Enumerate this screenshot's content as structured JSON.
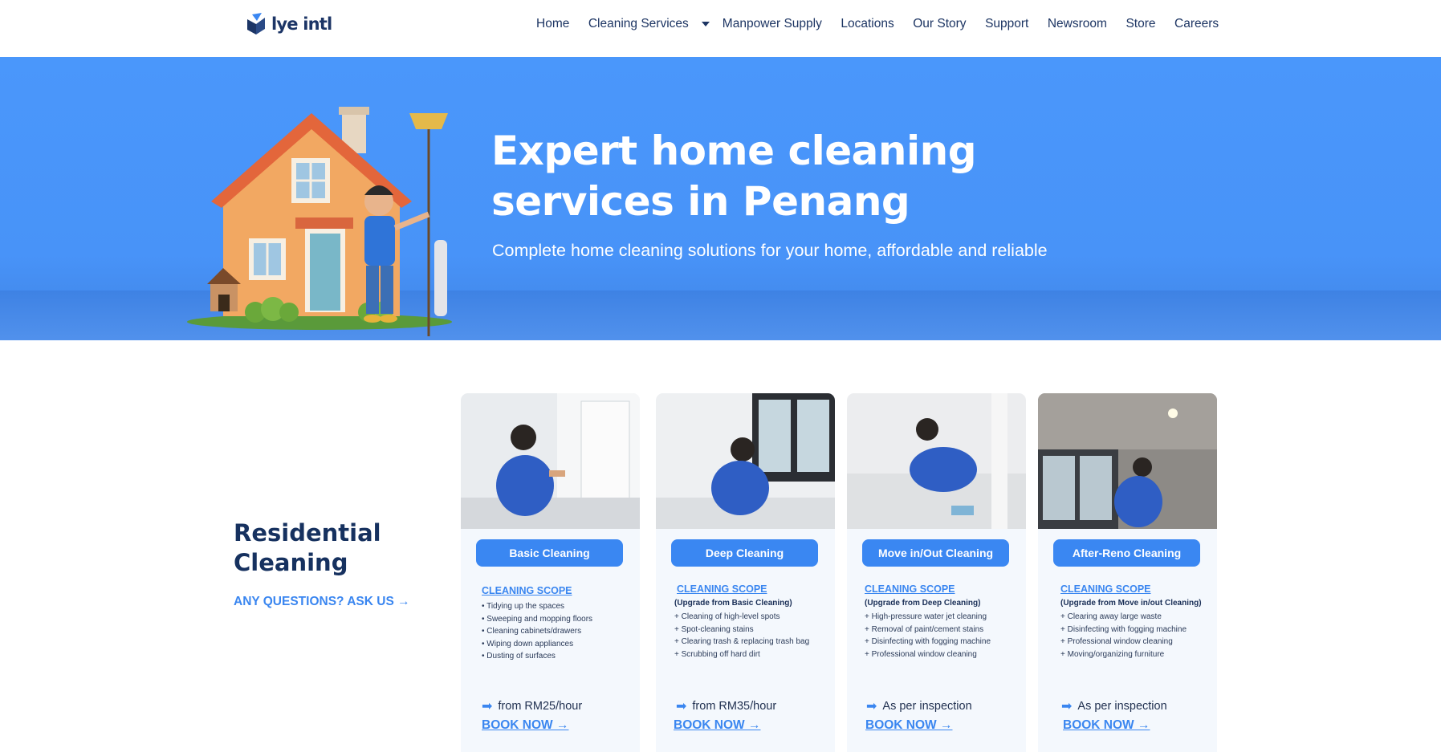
{
  "brand": {
    "name": "lye intl",
    "accent": "#3a87f2",
    "navy": "#16315f"
  },
  "nav": {
    "items": [
      "Home",
      "Cleaning Services",
      "Manpower Supply",
      "Locations",
      "Our Story",
      "Support",
      "Newsroom",
      "Store",
      "Careers"
    ],
    "dropdown_icon": "chevron-down-icon"
  },
  "hero": {
    "title": "Expert home cleaning services in Penang",
    "subtitle": "Complete home cleaning solutions for your home, affordable and reliable",
    "bg_color": "#4a97fb"
  },
  "section": {
    "title": "Residential Cleaning",
    "ask": "ANY QUESTIONS? ASK US →"
  },
  "cards": [
    {
      "button": "Basic Cleaning",
      "scope_title": "CLEANING SCOPE",
      "scope_sub": "",
      "scope": [
        "• Tidying up the spaces",
        "• Sweeping and mopping floors",
        "• Cleaning cabinets/drawers",
        "• Wiping down appliances",
        "• Dusting of surfaces"
      ],
      "price": "from RM25/hour",
      "book": "BOOK NOW →"
    },
    {
      "button": "Deep Cleaning",
      "scope_title": "CLEANING SCOPE",
      "scope_sub": "(Upgrade from Basic Cleaning)",
      "scope": [
        "+ Cleaning of high-level spots",
        "+ Spot-cleaning stains",
        "+ Clearing trash & replacing trash bag",
        "+ Scrubbing off hard dirt"
      ],
      "price": "from RM35/hour",
      "book": "BOOK NOW →"
    },
    {
      "button": "Move in/Out Cleaning",
      "scope_title": "CLEANING SCOPE",
      "scope_sub": "(Upgrade from Deep Cleaning)",
      "scope": [
        "+ High-pressure water jet cleaning",
        "+ Removal of paint/cement stains",
        "+ Disinfecting with fogging machine",
        "+ Professional window cleaning"
      ],
      "price": "As per inspection",
      "book": "BOOK NOW →"
    },
    {
      "button": "After-Reno Cleaning",
      "scope_title": "CLEANING SCOPE",
      "scope_sub": "(Upgrade from Move in/out Cleaning)",
      "scope": [
        "+ Clearing away large waste",
        "+ Disinfecting with fogging machine",
        "+ Professional window cleaning",
        "+ Moving/organizing furniture"
      ],
      "price": "As per inspection",
      "book": "BOOK NOW →"
    }
  ]
}
